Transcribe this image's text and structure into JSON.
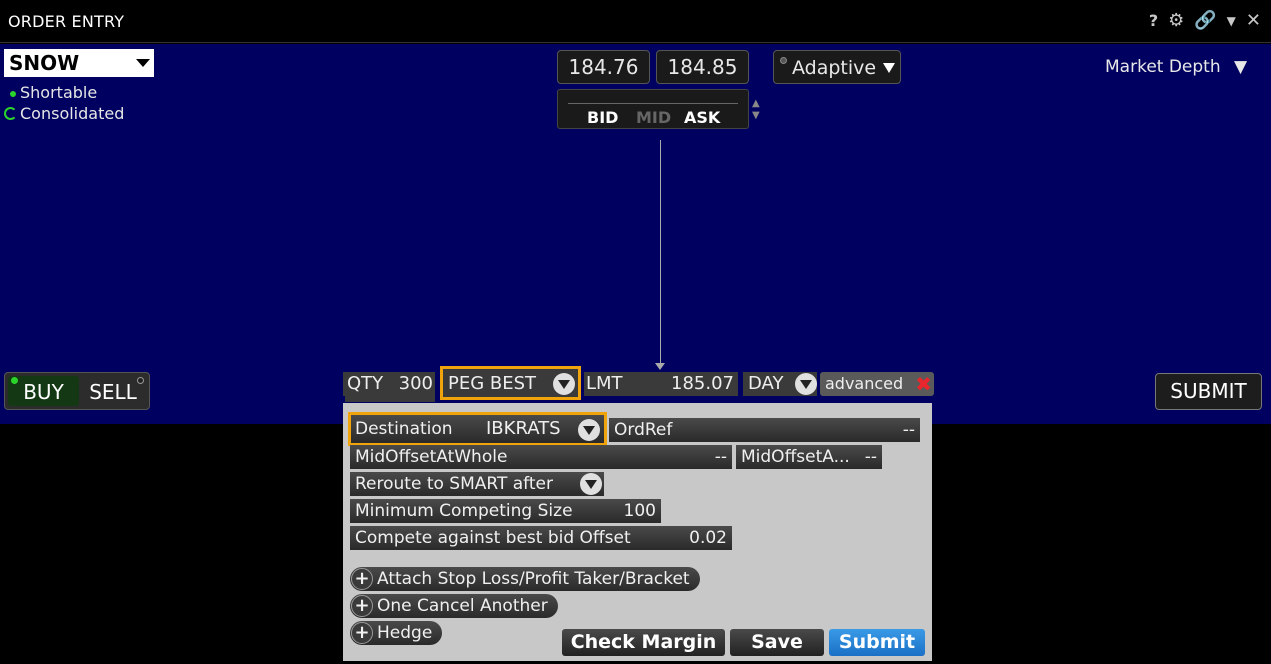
{
  "window": {
    "title": "ORDER ENTRY"
  },
  "title_icons": {
    "help": "?",
    "settings": "gear-icon",
    "link": "link-icon",
    "menu": "chevron-down-icon",
    "close": "close-icon"
  },
  "symbol": {
    "value": "SNOW",
    "shortable": "Shortable",
    "consolidated": "Consolidated"
  },
  "quote": {
    "bid": "184.76",
    "ask": "184.85",
    "bid_label": "BID",
    "mid_label": "MID",
    "ask_label": "ASK"
  },
  "algo": {
    "label": "Adaptive"
  },
  "market_depth": {
    "label": "Market Depth"
  },
  "side": {
    "buy": "BUY",
    "sell": "SELL"
  },
  "order": {
    "qty_label": "QTY",
    "qty_value": "300",
    "type": "PEG BEST",
    "lmt_label": "LMT",
    "lmt_value": "185.07",
    "tif": "DAY",
    "advanced": "advanced"
  },
  "submit_top": "SUBMIT",
  "advanced_panel": {
    "destination_label": "Destination",
    "destination_value": "IBKRATS",
    "ordref_label": "OrdRef",
    "ordref_value": "--",
    "midoffset_whole_label": "MidOffsetAtWhole",
    "midoffset_whole_value": "--",
    "midoffset_a_label": "MidOffsetA...",
    "midoffset_a_value": "--",
    "reroute_label": "Reroute to SMART after",
    "min_competing_label": "Minimum Competing Size",
    "min_competing_value": "100",
    "compete_label": "Compete against best bid Offset",
    "compete_value": "0.02",
    "attach_label": "Attach Stop Loss/Profit Taker/Bracket",
    "oca_label": "One Cancel Another",
    "hedge_label": "Hedge",
    "check_margin": "Check Margin",
    "save": "Save",
    "submit": "Submit"
  },
  "colors": {
    "panel_bg": "#000060",
    "highlight": "#f0a30a",
    "submit_blue": "#1a70c6",
    "cancel_red": "#e8262c",
    "green_led": "#2bd42b"
  }
}
